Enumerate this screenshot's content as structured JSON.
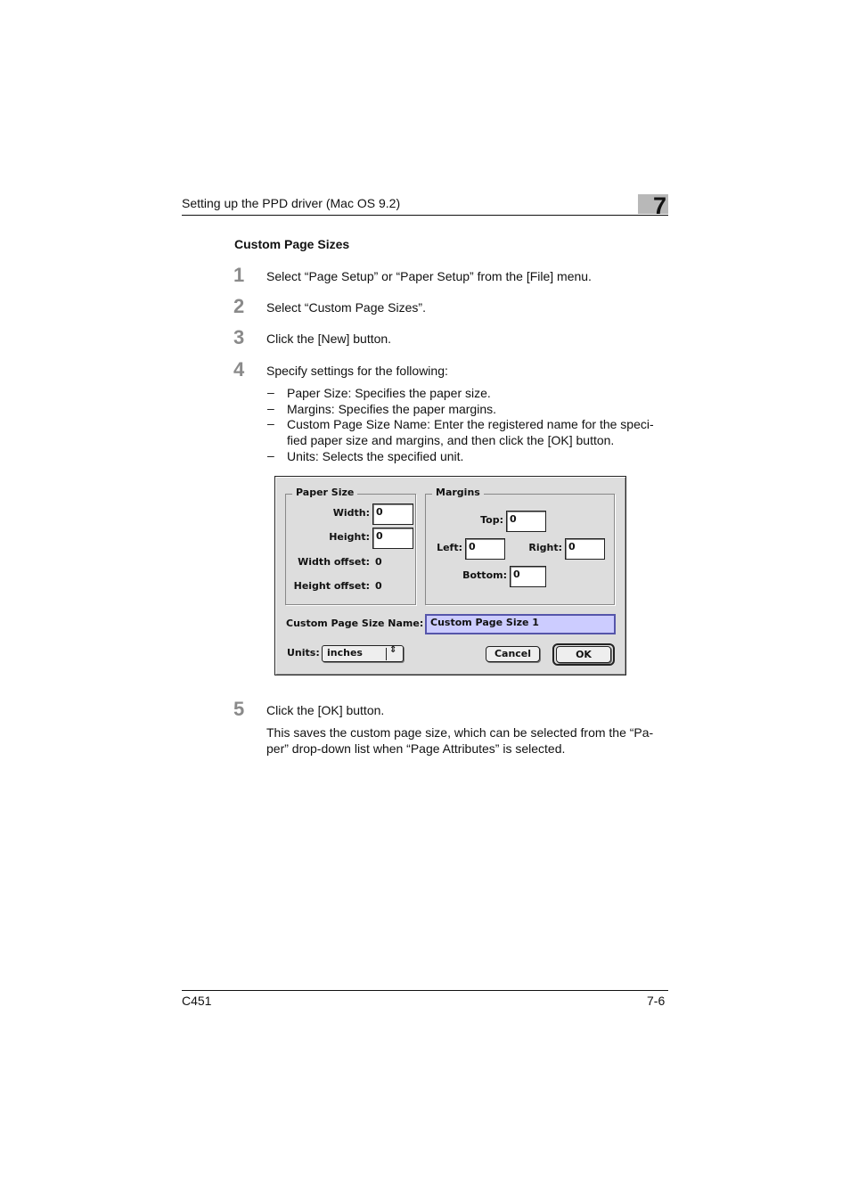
{
  "header": {
    "title": "Setting up the PPD driver (Mac OS 9.2)",
    "chapter": "7"
  },
  "section": {
    "title": "Custom Page Sizes"
  },
  "steps": [
    {
      "num": "1",
      "text": "Select “Page Setup” or “Paper Setup” from the [File] menu."
    },
    {
      "num": "2",
      "text": "Select “Custom Page Sizes”."
    },
    {
      "num": "3",
      "text": "Click the [New] button."
    },
    {
      "num": "4",
      "text": "Specify settings for the following:"
    },
    {
      "num": "5",
      "text": "Click the [OK] button."
    }
  ],
  "bullets": [
    {
      "dash": "–",
      "text": "Paper Size: Specifies the paper size."
    },
    {
      "dash": "–",
      "text": "Margins: Specifies the paper margins."
    },
    {
      "dash": "–",
      "text": "Custom Page Size Name: Enter the registered name for the speci-fied paper size and margins, and then click the [OK] button."
    },
    {
      "dash": "–",
      "text": "Units: Selects the specified unit."
    }
  ],
  "step5_note": "This saves the custom page size, which can be selected from the “Pa-per” drop-down list when “Page Attributes” is selected.",
  "dialog": {
    "paper_size": {
      "group_label": "Paper Size",
      "width_label": "Width:",
      "width_value": "0",
      "height_label": "Height:",
      "height_value": "0",
      "width_offset_label": "Width offset:",
      "width_offset_value": "0",
      "height_offset_label": "Height offset:",
      "height_offset_value": "0"
    },
    "margins": {
      "group_label": "Margins",
      "top_label": "Top:",
      "top_value": "0",
      "left_label": "Left:",
      "left_value": "0",
      "right_label": "Right:",
      "right_value": "0",
      "bottom_label": "Bottom:",
      "bottom_value": "0"
    },
    "name_label": "Custom Page Size Name:",
    "name_value": "Custom Page Size 1",
    "units_label": "Units:",
    "units_value": "inches",
    "cancel_label": "Cancel",
    "ok_label": "OK"
  },
  "footer": {
    "model": "C451",
    "page": "7-6"
  }
}
